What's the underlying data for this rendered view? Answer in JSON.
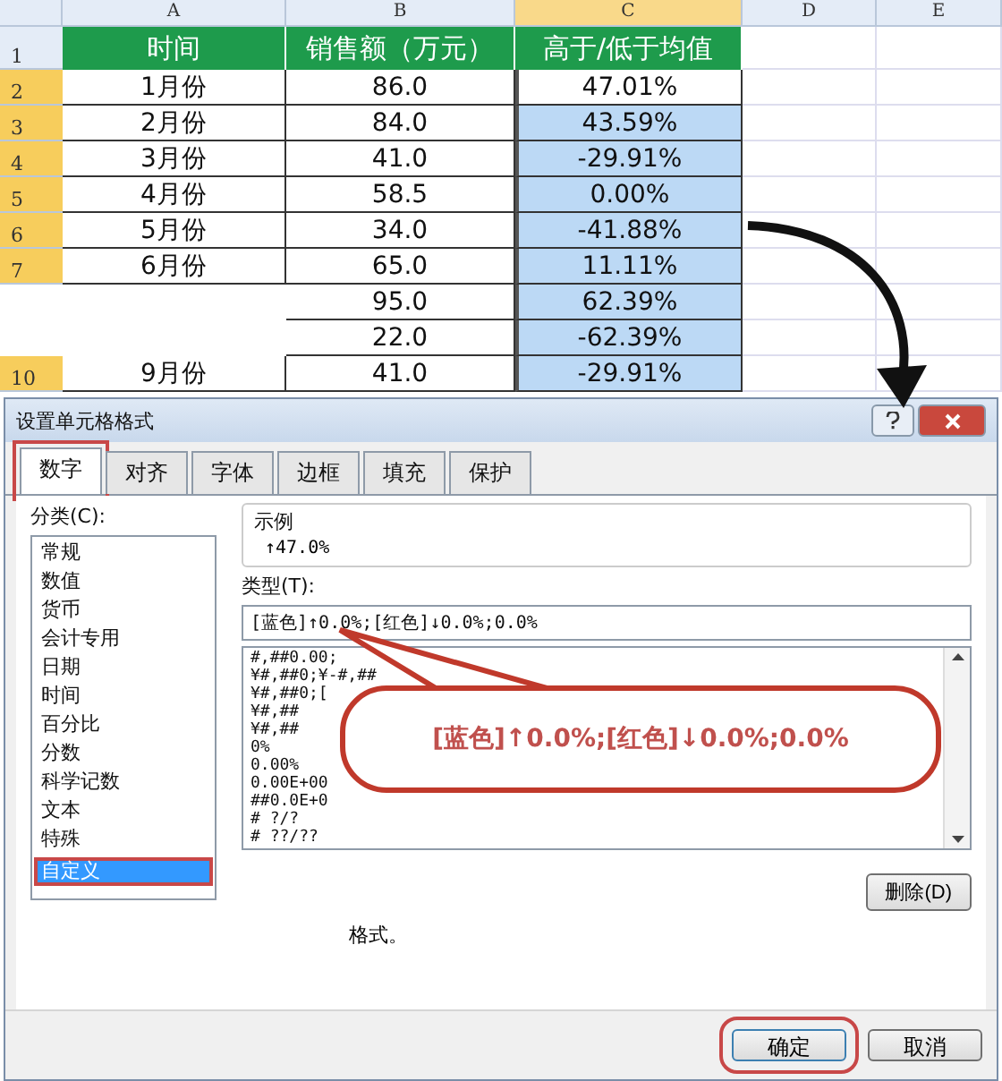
{
  "sheet": {
    "columns": [
      {
        "label": "A",
        "selected": false
      },
      {
        "label": "B",
        "selected": false
      },
      {
        "label": "C",
        "selected": true
      },
      {
        "label": "D",
        "selected": false
      },
      {
        "label": "E",
        "selected": false
      }
    ],
    "header_row": {
      "row": "1",
      "cells": [
        "时间",
        "销售额（万元）",
        "高于/低于均值"
      ]
    },
    "rows": [
      {
        "row": "2",
        "selected": true,
        "active": true,
        "month": "1月份",
        "sales": "86.0",
        "diff": "47.01%"
      },
      {
        "row": "3",
        "selected": true,
        "active": false,
        "month": "2月份",
        "sales": "84.0",
        "diff": "43.59%"
      },
      {
        "row": "4",
        "selected": true,
        "active": false,
        "month": "3月份",
        "sales": "41.0",
        "diff": "-29.91%"
      },
      {
        "row": "5",
        "selected": true,
        "active": false,
        "month": "4月份",
        "sales": "58.5",
        "diff": "0.00%"
      },
      {
        "row": "6",
        "selected": true,
        "active": false,
        "month": "5月份",
        "sales": "34.0",
        "diff": "-41.88%"
      },
      {
        "row": "7",
        "selected": true,
        "active": false,
        "month": "6月份",
        "sales": "65.0",
        "diff": "11.11%"
      },
      {
        "selected": true,
        "active": false,
        "sales": "95.0",
        "diff": "62.39%"
      },
      {
        "selected": true,
        "active": false,
        "sales": "22.0",
        "diff": "-62.39%"
      },
      {
        "row": "10",
        "selected": true,
        "active": false,
        "month": "9月份",
        "sales": "41.0",
        "diff": "-29.91%"
      }
    ]
  },
  "dialog": {
    "title": "设置单元格格式",
    "tabs": [
      {
        "label": "数字",
        "selected": true,
        "highlighted": true
      },
      {
        "label": "对齐",
        "selected": false,
        "highlighted": false
      },
      {
        "label": "字体",
        "selected": false,
        "highlighted": false
      },
      {
        "label": "边框",
        "selected": false,
        "highlighted": false
      },
      {
        "label": "填充",
        "selected": false,
        "highlighted": false
      },
      {
        "label": "保护",
        "selected": false,
        "highlighted": false
      }
    ],
    "category_label": "分类(C):",
    "categories": [
      {
        "label": "常规",
        "selected": false,
        "highlighted": false
      },
      {
        "label": "数值",
        "selected": false,
        "highlighted": false
      },
      {
        "label": "货币",
        "selected": false,
        "highlighted": false
      },
      {
        "label": "会计专用",
        "selected": false,
        "highlighted": false
      },
      {
        "label": "日期",
        "selected": false,
        "highlighted": false
      },
      {
        "label": "时间",
        "selected": false,
        "highlighted": false
      },
      {
        "label": "百分比",
        "selected": false,
        "highlighted": false
      },
      {
        "label": "分数",
        "selected": false,
        "highlighted": false
      },
      {
        "label": "科学记数",
        "selected": false,
        "highlighted": false
      },
      {
        "label": "文本",
        "selected": false,
        "highlighted": false
      },
      {
        "label": "特殊",
        "selected": false,
        "highlighted": false
      },
      {
        "label": "自定义",
        "selected": true,
        "highlighted": true
      }
    ],
    "sample_label": "示例",
    "sample": "↑47.0%",
    "type_label": "类型(T):",
    "type_value": "[蓝色]↑0.0%;[红色]↓0.0%;0.0%",
    "type_list": [
      "#,##0.00;",
      "¥#,##0;¥-#,##",
      "¥#,##0;[",
      "¥#,##",
      "¥#,##",
      "0%",
      "0.00%",
      "0.00E+00",
      "##0.0E+0",
      "# ?/?",
      "# ??/??"
    ],
    "delete_button": "删除(D)",
    "note": "格式。",
    "buttons": [
      {
        "label": "确定",
        "highlighted": true
      },
      {
        "label": "取消",
        "highlighted": false
      }
    ]
  },
  "callout": {
    "text": "[蓝色]↑0.0%;[红色]↓0.0%;0.0%"
  }
}
